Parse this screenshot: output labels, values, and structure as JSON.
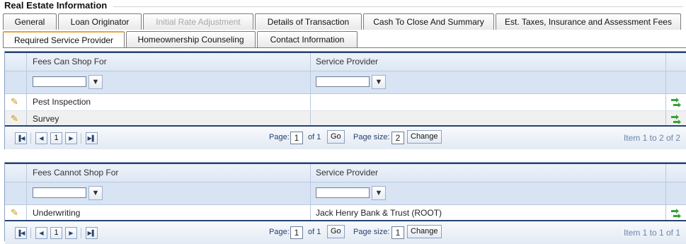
{
  "page": {
    "title": "Real Estate Information"
  },
  "tabs_row1": [
    {
      "label": "General"
    },
    {
      "label": "Loan Originator"
    },
    {
      "label": "Initial Rate Adjustment"
    },
    {
      "label": "Details of Transaction"
    },
    {
      "label": "Cash To Close And Summary"
    },
    {
      "label": "Est. Taxes, Insurance and Assessment Fees"
    }
  ],
  "tabs_row2": [
    {
      "label": "Required Service Provider"
    },
    {
      "label": "Homeownership Counseling"
    },
    {
      "label": "Contact Information"
    }
  ],
  "grid1": {
    "col1": "Fees Can Shop For",
    "col2": "Service Provider",
    "rows": [
      {
        "fee": "Pest Inspection",
        "provider": ""
      },
      {
        "fee": "Survey",
        "provider": ""
      }
    ],
    "pager": {
      "page_label": "Page:",
      "page": "1",
      "of": "of 1",
      "go": "Go",
      "size_label": "Page size:",
      "size": "2",
      "change": "Change",
      "current": "1",
      "count": "Item 1 to 2 of 2"
    }
  },
  "grid2": {
    "col1": "Fees Cannot Shop For",
    "col2": "Service Provider",
    "rows": [
      {
        "fee": "Underwriting",
        "provider": "Jack Henry Bank & Trust (ROOT)"
      }
    ],
    "pager": {
      "page_label": "Page:",
      "page": "1",
      "of": "of 1",
      "go": "Go",
      "size_label": "Page size:",
      "size": "1",
      "change": "Change",
      "current": "1",
      "count": "Item 1 to 1 of 1"
    }
  },
  "icons": {
    "edit": "pencil-icon",
    "filter": "filter-icon",
    "go": "green-arrow-icon"
  }
}
